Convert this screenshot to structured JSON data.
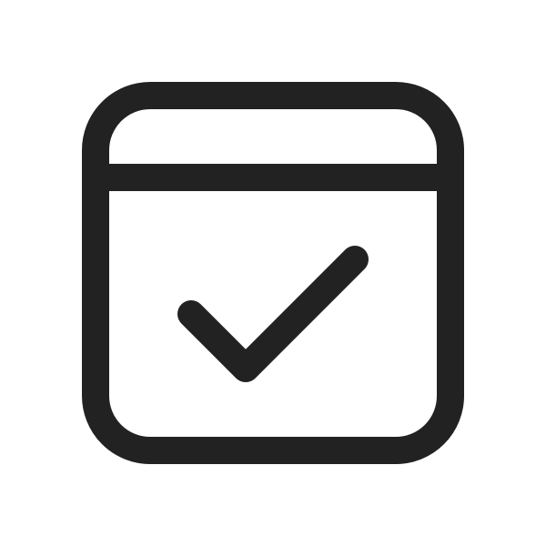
{
  "icon": {
    "name": "calendar-checkmark",
    "stroke_color": "#222222",
    "background_color": "#ffffff"
  }
}
